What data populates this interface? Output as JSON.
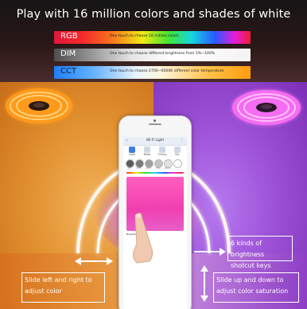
{
  "headline": "Play with 16 million colors and shades of white",
  "modes": [
    {
      "label": "RGB",
      "desc": "One touch to choose 16 million colors"
    },
    {
      "label": "DIM",
      "desc": "One touch to choose different brightness from 1%~100%"
    },
    {
      "label": "CCT",
      "desc": "One touch to choose 2700~6500K different color temperature"
    }
  ],
  "phone": {
    "title": "Wi-Fi Light",
    "tabs": [
      "Light",
      "Mode",
      "Timing",
      "Mic"
    ],
    "circle_labels": [
      "1%",
      "25%",
      "50%",
      "75%",
      "100%",
      ""
    ],
    "brightness_label": "Brightness 100%"
  },
  "callouts": {
    "slide_lr": "Slide left and right to adjust color",
    "shortcut": "6 kinds of brightness shotcut keys",
    "slide_ud": "Slide up and down to adjust color saturation"
  },
  "colors": {
    "warm": "#e39331",
    "purple": "#9e52d8",
    "pink_panel": "#f03fb0",
    "accent_blue": "#3c7fe0"
  },
  "icons": [
    "back-arrow-icon",
    "more-icon",
    "light-icon",
    "mode-icon",
    "timing-icon",
    "mic-icon",
    "double-arrow-horizontal-icon",
    "double-arrow-vertical-icon",
    "arrow-right-icon",
    "hand-pointer-icon",
    "led-strip-reel-icon"
  ]
}
